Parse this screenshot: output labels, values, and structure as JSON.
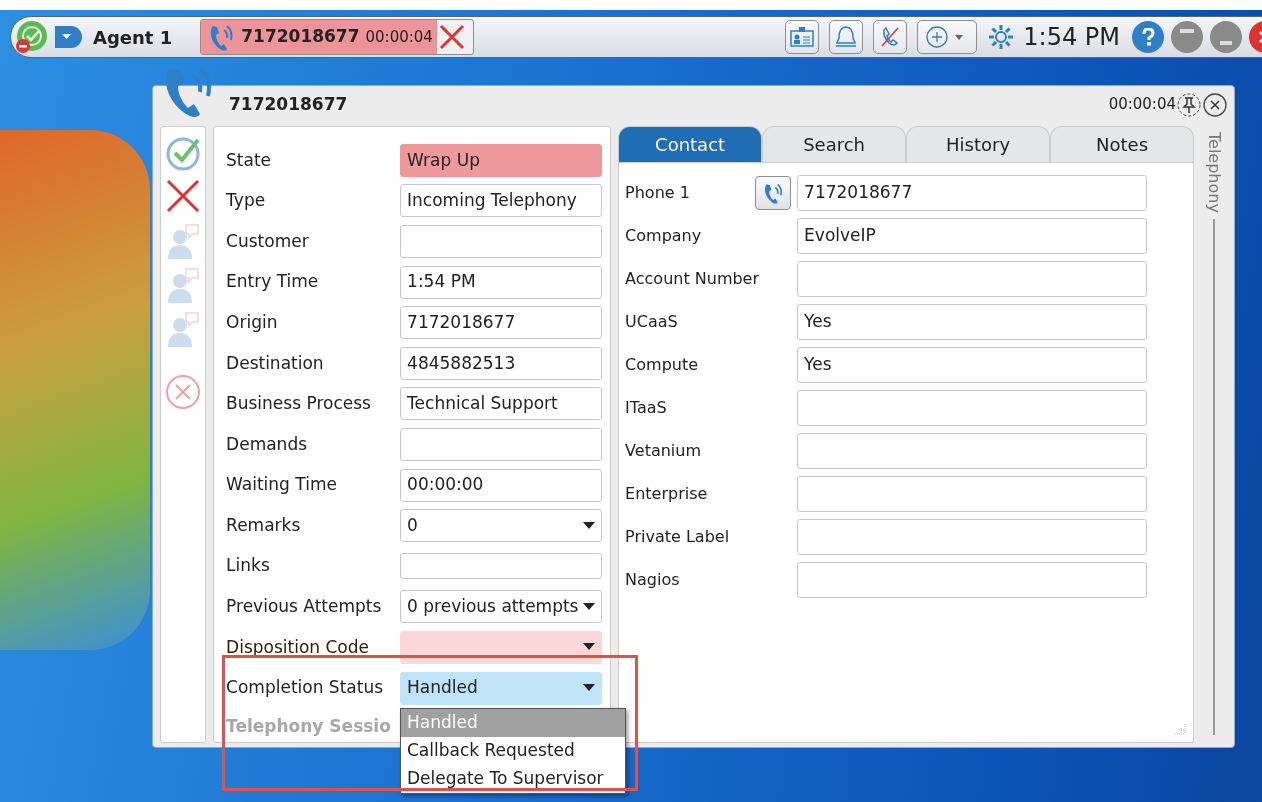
{
  "toolbar": {
    "agent_name": "Agent 1",
    "call_tab": {
      "number": "7172018677",
      "timer": "00:00:04"
    },
    "clock": "1:54 PM"
  },
  "window": {
    "title": "7172018677",
    "timer": "00:00:04"
  },
  "side_actions": [
    {
      "kind": "accept",
      "disabled": false
    },
    {
      "kind": "reject",
      "disabled": false
    },
    {
      "kind": "person",
      "disabled": true
    },
    {
      "kind": "person",
      "disabled": true
    },
    {
      "kind": "person",
      "disabled": true
    },
    {
      "kind": "cancel",
      "disabled": true
    }
  ],
  "interaction_fields": [
    {
      "label": "State",
      "value": "Wrap Up",
      "kind": "status"
    },
    {
      "label": "Type",
      "value": "Incoming Telephony",
      "kind": "text"
    },
    {
      "label": "Customer",
      "kind": "text"
    },
    {
      "label": "Entry Time",
      "value": "1:54 PM",
      "kind": "text"
    },
    {
      "label": "Origin",
      "value": "7172018677",
      "kind": "text"
    },
    {
      "label": "Destination",
      "value": "4845882513",
      "kind": "text"
    },
    {
      "label": "Business Process",
      "value": "Technical Support",
      "kind": "text"
    },
    {
      "label": "Demands",
      "kind": "text"
    },
    {
      "label": "Waiting Time",
      "value": "00:00:00",
      "kind": "text"
    },
    {
      "label": "Remarks",
      "value": "0",
      "kind": "select"
    },
    {
      "label": "Links",
      "kind": "text"
    },
    {
      "label": "Previous Attempts",
      "value": "0 previous attempts",
      "kind": "select"
    },
    {
      "label": "Disposition Code",
      "kind": "select",
      "required": true
    },
    {
      "label": "Completion Status",
      "value": "Handled",
      "kind": "select",
      "focused": true
    }
  ],
  "section_label": "Telephony Sessio",
  "dropdown_options": [
    {
      "label": "Handled",
      "selected": true
    },
    {
      "label": "Callback Requested",
      "selected": false
    },
    {
      "label": "Delegate To Supervisor",
      "selected": false
    }
  ],
  "tabs": [
    {
      "label": "Contact",
      "selected": true
    },
    {
      "label": "Search",
      "selected": false
    },
    {
      "label": "History",
      "selected": false
    },
    {
      "label": "Notes",
      "selected": false
    }
  ],
  "contact_fields": [
    {
      "label": "Phone 1",
      "value": "7172018677",
      "call_button": true
    },
    {
      "label": "Company",
      "value": "EvolveIP"
    },
    {
      "label": "Account Number"
    },
    {
      "label": "UCaaS",
      "value": "Yes"
    },
    {
      "label": "Compute",
      "value": "Yes"
    },
    {
      "label": "ITaaS"
    },
    {
      "label": "Vetanium"
    },
    {
      "label": "Enterprise"
    },
    {
      "label": "Private Label"
    },
    {
      "label": "Nagios"
    }
  ],
  "side_tab": "Telephony"
}
